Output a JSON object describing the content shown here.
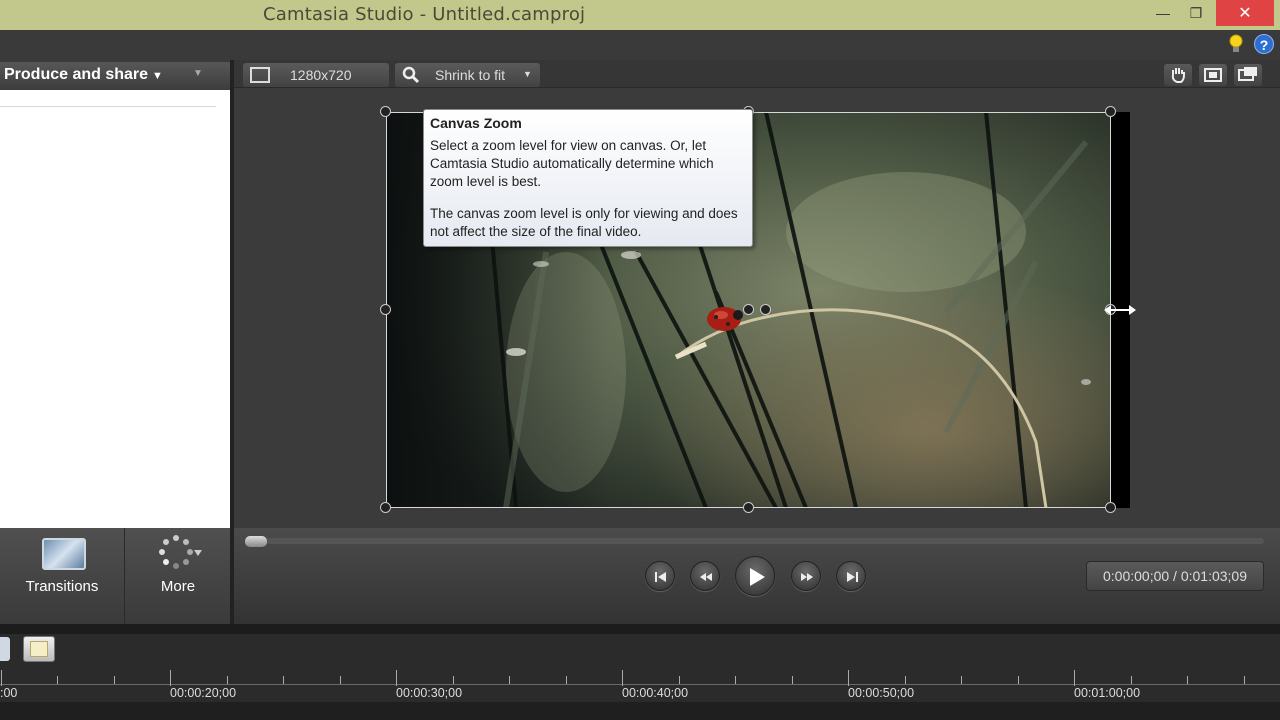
{
  "window": {
    "title": "Camtasia Studio - Untitled.camproj",
    "minimize": "—",
    "restore": "❐",
    "close": "✕"
  },
  "left_panel": {
    "produce_label": "Produce and share",
    "tiles": [
      {
        "label": "Transitions",
        "icon": "transitions-icon"
      },
      {
        "label": "More",
        "icon": "more-icon"
      }
    ]
  },
  "canvas_toolbar": {
    "dimensions": "1280x720",
    "zoom_value": "Shrink to fit",
    "buttons": [
      "hand-icon",
      "fit-icon",
      "detach-icon"
    ]
  },
  "tooltip": {
    "title": "Canvas Zoom",
    "paragraph1": "Select a zoom level for view on canvas.  Or, let Camtasia Studio automatically determine which zoom level is best.",
    "paragraph2": "The canvas zoom level is only for viewing and does not affect the size of the final video."
  },
  "playback": {
    "progress": 0,
    "time": "0:00:00;00 / 0:01:03;09",
    "controls": [
      "skip-back-icon",
      "rewind-icon",
      "play-icon",
      "fast-forward-icon",
      "skip-forward-icon"
    ]
  },
  "timeline": {
    "ruler_labels": [
      ":00",
      "00:00:20;00",
      "00:00:30;00",
      "00:00:40;00",
      "00:00:50;00",
      "00:01:00;00"
    ]
  },
  "colors": {
    "titlebar": "#c2c88c",
    "close_button": "#e04343",
    "panel": "#3b3b3b",
    "timeline": "#2b2b2b"
  }
}
